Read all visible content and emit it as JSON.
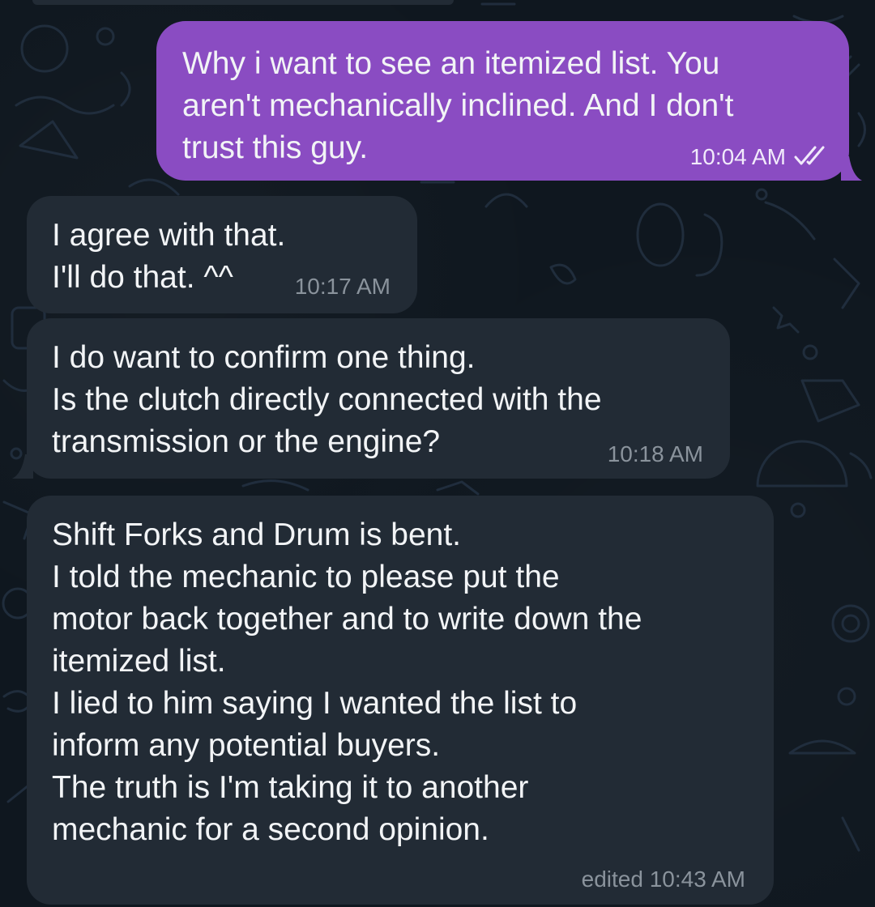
{
  "colors": {
    "background": "#0f171f",
    "incoming_bubble": "#222b35",
    "outgoing_bubble": "#8a4cc2",
    "message_text": "#f2f4f6",
    "incoming_time": "#8a939c",
    "outgoing_time": "#f1eafb"
  },
  "messages": [
    {
      "direction": "outgoing",
      "text": "Why i want to see an itemized list. You\naren't mechanically inclined. And I don't\ntrust this guy.",
      "time": "10:04 AM",
      "status_icon": "double-check-icon"
    },
    {
      "direction": "incoming",
      "text": "I agree with that.\nI'll do that. ^^",
      "time": "10:17 AM"
    },
    {
      "direction": "incoming",
      "text": "I do want to confirm one thing.\nIs the clutch directly connected with the\ntransmission or the engine?",
      "time": "10:18 AM"
    },
    {
      "direction": "incoming",
      "text": "Shift Forks and Drum is bent.\nI told the mechanic to please put the\nmotor back together and to write down the\nitemized list.\nI lied to him saying I wanted the list to\ninform any potential buyers.\nThe truth is I'm taking it to another\nmechanic for a second opinion.",
      "time": "edited 10:43 AM"
    }
  ]
}
